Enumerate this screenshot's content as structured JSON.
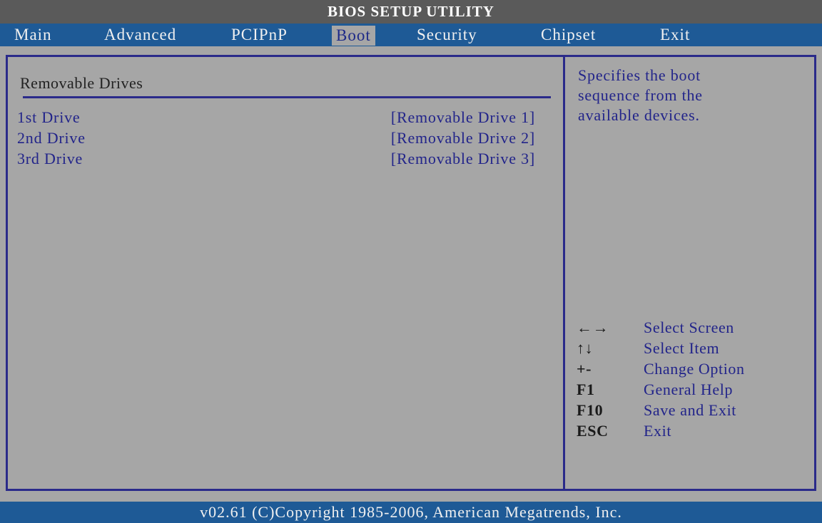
{
  "window": {
    "title": "BIOS SETUP UTILITY"
  },
  "menu": {
    "tabs": [
      {
        "label": "Main"
      },
      {
        "label": "Advanced"
      },
      {
        "label": "PCIPnP"
      },
      {
        "label": "Boot",
        "active": true
      },
      {
        "label": "Security"
      },
      {
        "label": "Chipset"
      },
      {
        "label": "Exit"
      }
    ]
  },
  "panel": {
    "section_title": "Removable Drives",
    "rows": [
      {
        "label": "1st Drive",
        "value": "[Removable Drive 1]"
      },
      {
        "label": "2nd Drive",
        "value": "[Removable Drive 2]"
      },
      {
        "label": "3rd Drive",
        "value": "[Removable Drive 3]"
      }
    ]
  },
  "help": {
    "lines": [
      "Specifies the boot",
      "sequence from the",
      "available devices."
    ]
  },
  "keys": [
    {
      "key": "←→",
      "desc": "Select Screen"
    },
    {
      "key": "↑↓",
      "desc": "Select Item"
    },
    {
      "key": "+-",
      "desc": "Change Option"
    },
    {
      "key": "F1",
      "desc": "General Help"
    },
    {
      "key": "F10",
      "desc": "Save and Exit"
    },
    {
      "key": "ESC",
      "desc": "Exit"
    }
  ],
  "footer": {
    "text": "v02.61 (C)Copyright 1985-2006, American Megatrends, Inc."
  },
  "colors": {
    "title_bar": "#5a5a5a",
    "menu_bar": "#1e5a96",
    "background": "#a6a6a6",
    "border": "#2a2a8a",
    "item_text": "#22248a"
  }
}
